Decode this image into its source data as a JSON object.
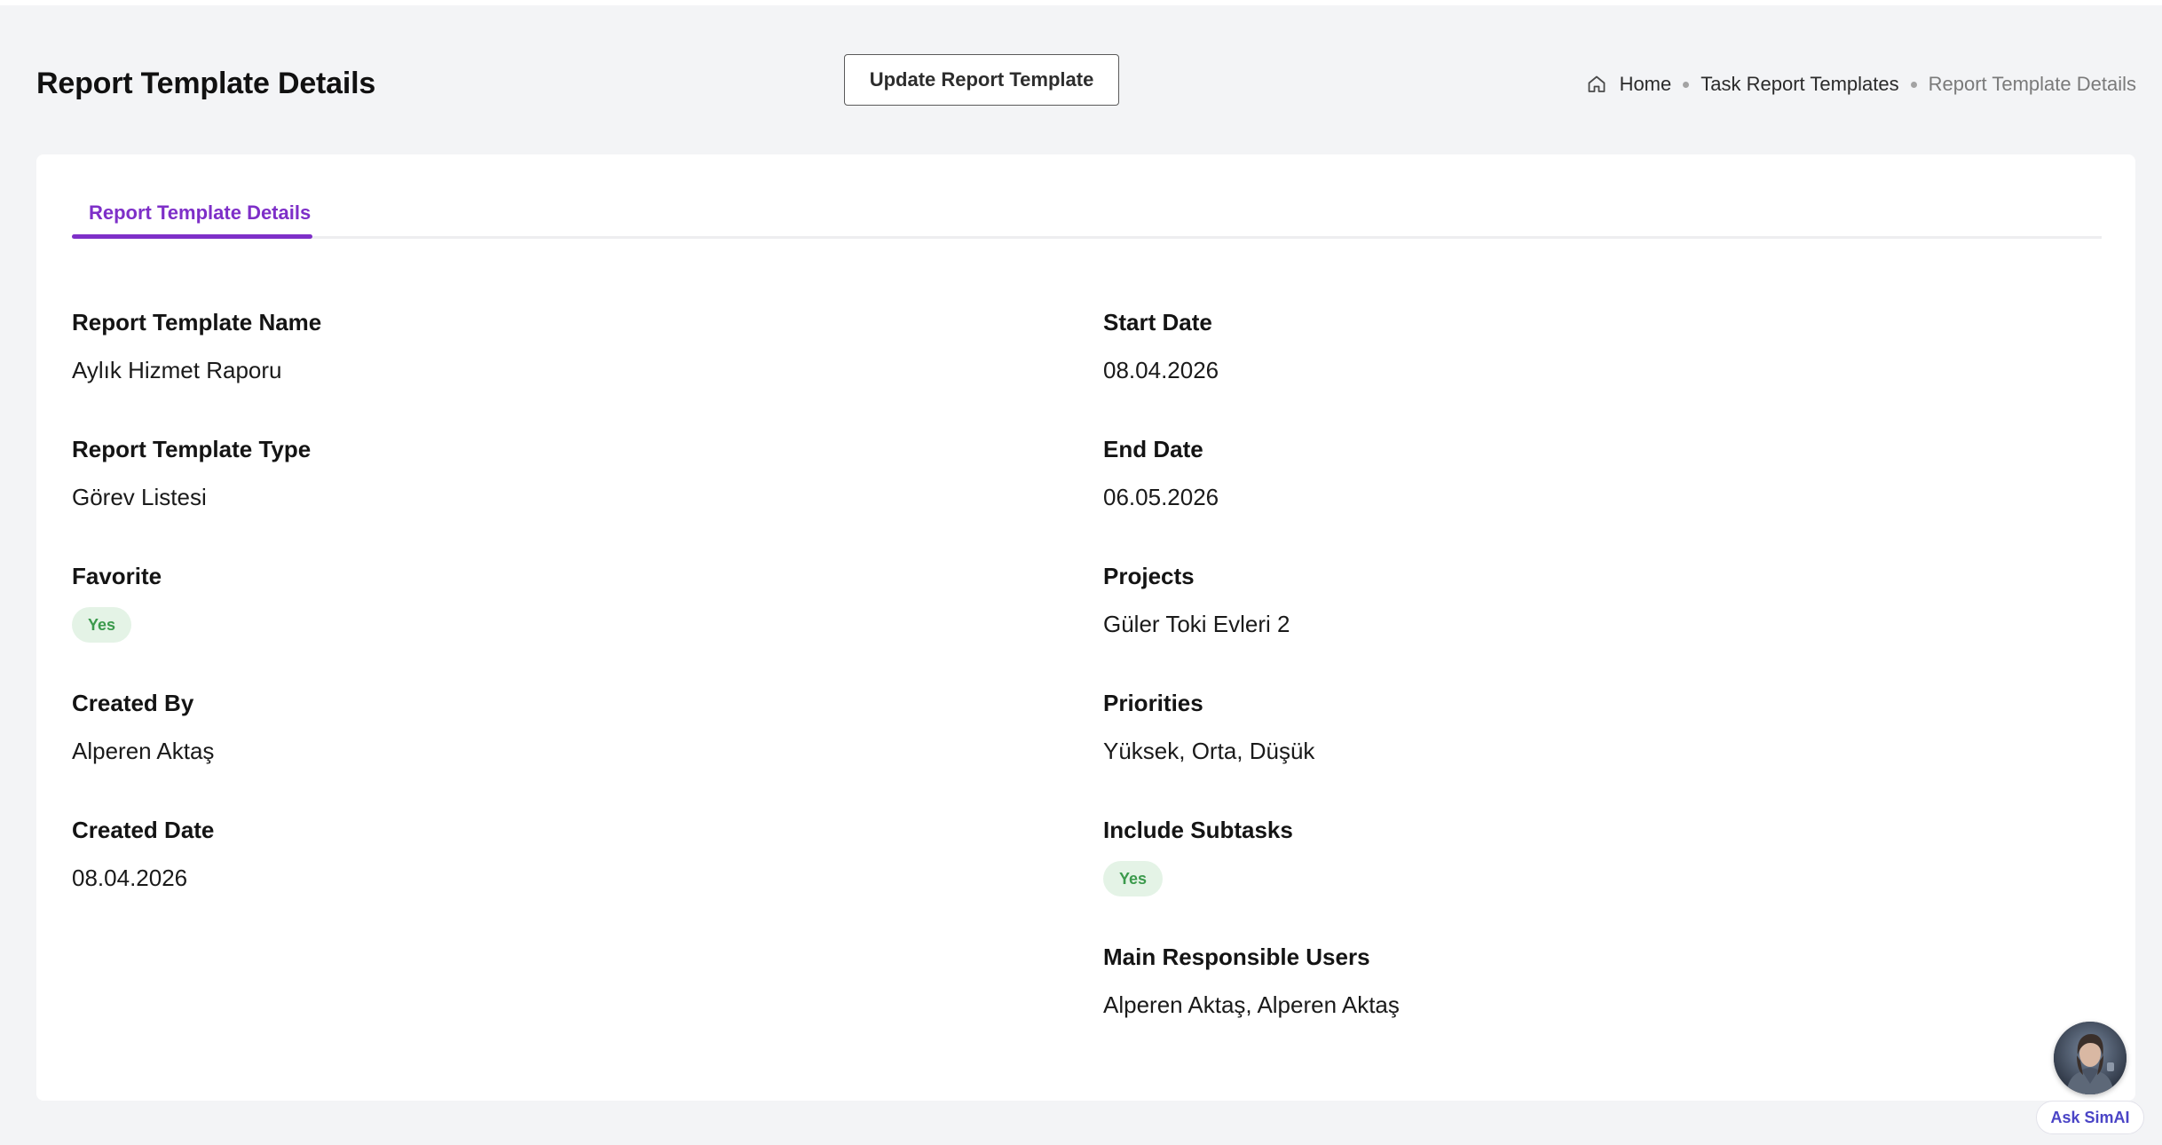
{
  "header": {
    "title": "Report Template Details",
    "update_button_label": "Update Report Template"
  },
  "breadcrumb": {
    "home_icon": "home-icon",
    "items": [
      "Home",
      "Task Report Templates",
      "Report Template Details"
    ]
  },
  "tabs": [
    {
      "label": "Report Template Details",
      "active": true
    }
  ],
  "details": {
    "left": [
      {
        "label": "Report Template Name",
        "value": "Aylık Hizmet Raporu"
      },
      {
        "label": "Report Template Type",
        "value": "Görev Listesi"
      },
      {
        "label": "Favorite",
        "badge": "Yes"
      },
      {
        "label": "Created By",
        "value": "Alperen Aktaş"
      },
      {
        "label": "Created Date",
        "value": "08.04.2026"
      }
    ],
    "right": [
      {
        "label": "Start Date",
        "value": "08.04.2026"
      },
      {
        "label": "End Date",
        "value": "06.05.2026"
      },
      {
        "label": "Projects",
        "value": "Güler Toki Evleri 2"
      },
      {
        "label": "Priorities",
        "value": "Yüksek, Orta, Düşük"
      },
      {
        "label": "Include Subtasks",
        "badge": "Yes"
      },
      {
        "label": "Main Responsible Users",
        "value": "Alperen Aktaş, Alperen Aktaş"
      }
    ]
  },
  "assistant": {
    "label": "Ask SimAI",
    "avatar_icon": "assistant-avatar-icon"
  },
  "colors": {
    "accent": "#7e2fc8",
    "badge_bg": "#e4f3e6",
    "badge_text": "#3b9a4c",
    "page_bg": "#f3f4f6",
    "assistant_text": "#4a44c6"
  }
}
